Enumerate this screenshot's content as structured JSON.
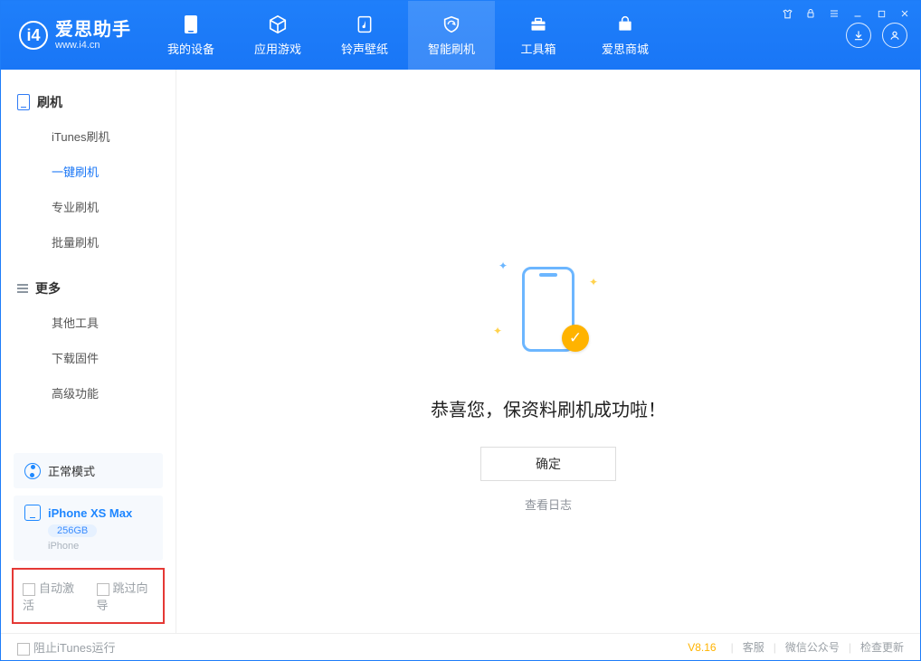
{
  "app": {
    "name": "爱思助手",
    "domain": "www.i4.cn"
  },
  "nav": {
    "items": [
      {
        "label": "我的设备"
      },
      {
        "label": "应用游戏"
      },
      {
        "label": "铃声壁纸"
      },
      {
        "label": "智能刷机"
      },
      {
        "label": "工具箱"
      },
      {
        "label": "爱思商城"
      }
    ],
    "activeIndex": 3
  },
  "sidebar": {
    "group_flash": {
      "title": "刷机",
      "items": [
        "iTunes刷机",
        "一键刷机",
        "专业刷机",
        "批量刷机"
      ],
      "activeIndex": 1
    },
    "group_more": {
      "title": "更多",
      "items": [
        "其他工具",
        "下载固件",
        "高级功能"
      ]
    }
  },
  "mode": {
    "label": "正常模式"
  },
  "device": {
    "name": "iPhone XS Max",
    "capacity": "256GB",
    "type": "iPhone"
  },
  "options": {
    "auto_activate": "自动激活",
    "skip_guide": "跳过向导"
  },
  "main": {
    "success_text": "恭喜您，保资料刷机成功啦！",
    "ok_label": "确定",
    "view_log": "查看日志"
  },
  "footer": {
    "block_itunes": "阻止iTunes运行",
    "version": "V8.16",
    "links": [
      "客服",
      "微信公众号",
      "检查更新"
    ]
  }
}
